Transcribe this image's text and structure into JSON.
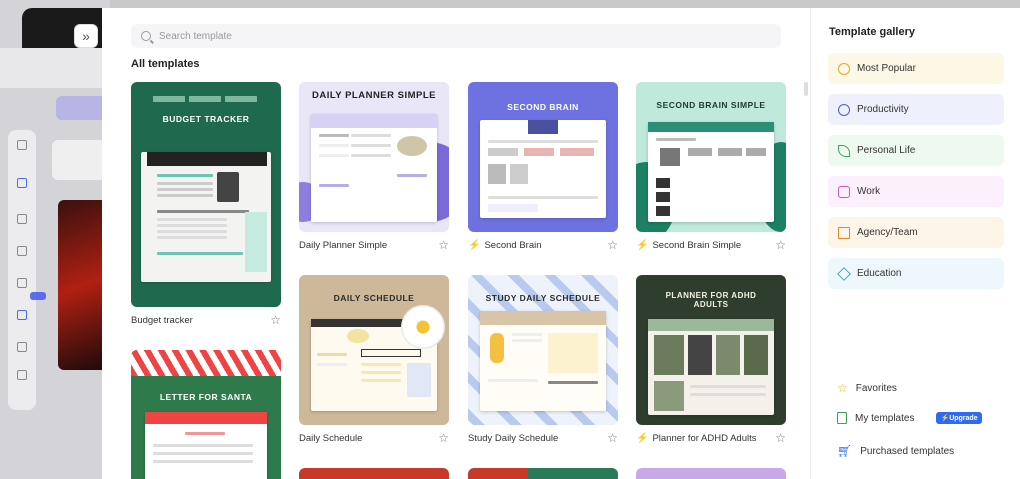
{
  "sidebar_toggle": {
    "icon": "double-chevron-right-icon",
    "glyph": "»"
  },
  "search": {
    "placeholder": "Search template"
  },
  "section": {
    "title": "All templates"
  },
  "templates": [
    {
      "label": "Budget tracker",
      "thumb_title": "BUDGET TRACKER",
      "featured": false
    },
    {
      "label": "Daily Planner Simple",
      "thumb_title": "DAILY PLANNER SIMPLE",
      "featured": false
    },
    {
      "label": "Second Brain",
      "thumb_title": "SECOND BRAIN",
      "featured": true
    },
    {
      "label": "Second Brain Simple",
      "thumb_title": "SECOND BRAIN SIMPLE",
      "featured": true
    },
    {
      "label": "Daily Schedule",
      "thumb_title": "DAILY SCHEDULE",
      "featured": false
    },
    {
      "label": "Study Daily Schedule",
      "thumb_title": "STUDY DAILY SCHEDULE",
      "featured": false
    },
    {
      "label": "Planner for ADHD Adults",
      "thumb_title": "PLANNER FOR ADHD ADULTS",
      "featured": true
    },
    {
      "label": "Letter for Santa",
      "thumb_title": "LETTER FOR SANTA",
      "featured": false
    }
  ],
  "gallery": {
    "title": "Template gallery",
    "categories": [
      {
        "label": "Most Popular",
        "icon": "medal-icon",
        "color": "#fdf7e6"
      },
      {
        "label": "Productivity",
        "icon": "chart-pie-icon",
        "color": "#eef1fb"
      },
      {
        "label": "Personal Life",
        "icon": "leaf-icon",
        "color": "#eefaf0"
      },
      {
        "label": "Work",
        "icon": "briefcase-icon",
        "color": "#fbf0fb"
      },
      {
        "label": "Agency/Team",
        "icon": "document-icon",
        "color": "#fdf6e8"
      },
      {
        "label": "Education",
        "icon": "graduation-cap-icon",
        "color": "#eef7fb"
      }
    ],
    "links": [
      {
        "label": "Favorites",
        "icon": "star-icon"
      },
      {
        "label": "My templates",
        "icon": "file-icon",
        "badge": "Upgrade"
      },
      {
        "label": "Purchased templates",
        "icon": "cart-icon"
      }
    ]
  },
  "colors": {
    "accent": "#2f6bf2",
    "featured_bolt": "#f2b01e"
  }
}
